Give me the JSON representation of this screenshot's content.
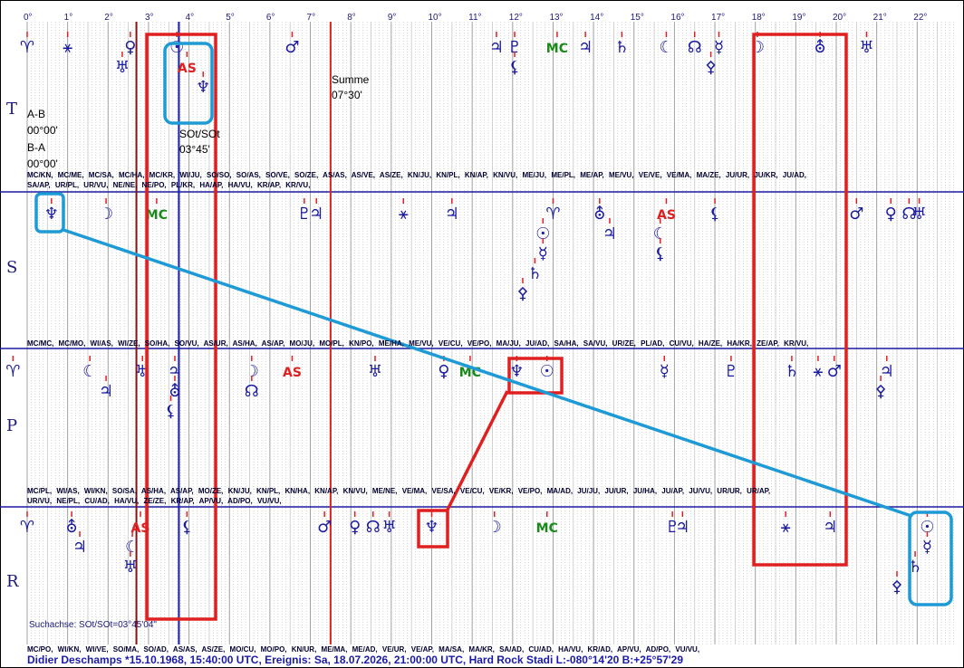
{
  "degree_labels": [
    "0°",
    "1°",
    "2°",
    "3°",
    "4°",
    "5°",
    "6°",
    "7°",
    "8°",
    "9°",
    "10°",
    "11°",
    "12°",
    "13°",
    "14°",
    "15°",
    "16°",
    "17°",
    "18°",
    "19°",
    "20°",
    "21°",
    "22°"
  ],
  "row_labels": [
    "T",
    "S",
    "P",
    "R"
  ],
  "info": {
    "ab_label": "A-B",
    "ab_value": "00°00'",
    "ba_label": "B-A",
    "ba_value": "00°00'",
    "summe_label": "Summe",
    "summe_value": "07°30'",
    "sot_label": "SOt/SOt",
    "sot_value": "03°45'"
  },
  "strips": {
    "strip1_line1": "MC/KN, MC/ME, MC/SA, MC/HA, MC/KR, WI/JU, SO/SO, SO/AS, SO/VE, SO/ZE, AS/AS, AS/VE, AS/ZE, KN/JU, KN/PL, KN/AP, KN/VU, ME/JU, ME/PL, ME/AP, ME/VU, VE/VE, VE/MA, MA/ZE, JU/UR, JU/KR, JU/AD,",
    "strip1_line2": "SA/AP, UR/PL, UR/VU, NE/NE, NE/PO, PL/KR, HA/AP, HA/VU, KR/AP, KR/VU,",
    "strip2_line1": "MC/MC, MC/MO, WI/AS, WI/ZE, SO/HA, SO/VU, AS/UR, AS/HA, AS/AP, MO/JU, MO/PL, KN/PO, ME/HA, ME/VU, VE/CU, VE/PO, MA/JU, JU/AD, SA/HA, SA/VU, UR/ZE, PL/AD, CU/VU, HA/ZE, HA/KR, ZE/AP, KR/VU,",
    "strip3_line1": "MC/PL, WI/AS, WI/KN, SO/SA, AS/HA, AS/AP, MO/ZE, KN/JU, KN/PL, KN/HA, KN/AP, KN/VU, ME/NE, VE/MA, VE/SA, VE/CU, VE/KR, VE/PO, MA/AD, JU/JU, JU/UR, JU/HA, JU/AP, JU/VU, UR/UR, UR/AP,",
    "strip3_line2": "UR/VU, NE/PL, CU/AD, HA/VU, ZE/ZE, KR/AP, AP/VU, AD/PO, VU/VU,",
    "strip4_line1": "MC/PO, WI/KN, WI/VE, SO/MA, SO/AD, AS/AS, AS/ZE, MO/CU, MO/PO, KN/UR, ME/MA, ME/AD, VE/UR, VE/AP, MA/SA, MA/KR, SA/AD, CU/AD, HA/VU, KR/AD, AP/VU, AD/PO, VU/VU,"
  },
  "search_axis": "Suchachse: SOt/SOt=03°45'04\"",
  "footer": "Didier Deschamps  *15.10.1968, 15:40:00 UTC, Ereignis: Sa, 18.07.2026, 21:00:00 UTC, Hard Rock Stadi L:-080°14'20 B:+25°57'29",
  "colors": {
    "navy": "#1a1aa0",
    "red": "#e02020",
    "green": "#1a8a1a",
    "cyan": "#1e9ad6",
    "grid": "#a0a0a0"
  },
  "symbols": [
    {
      "row": "T",
      "g": "♈",
      "v": 0,
      "t": 0,
      "c": "navy"
    },
    {
      "row": "T",
      "g": "⚹",
      "v": 1,
      "t": 0,
      "c": "navy"
    },
    {
      "row": "T",
      "g": "♀",
      "v": 2.55,
      "t": 0,
      "c": "navy"
    },
    {
      "row": "T",
      "g": "♅",
      "v": 2.35,
      "t": 1,
      "c": "navy"
    },
    {
      "row": "T",
      "g": "☉",
      "v": 3.7,
      "t": 0,
      "c": "navy"
    },
    {
      "row": "T",
      "g": "AS",
      "v": 3.95,
      "t": 1,
      "c": "red"
    },
    {
      "row": "T",
      "g": "♆",
      "v": 4.35,
      "t": 2,
      "c": "navy"
    },
    {
      "row": "T",
      "g": "♂",
      "v": 6.55,
      "t": 0,
      "c": "navy"
    },
    {
      "row": "T",
      "g": "♃",
      "v": 11.6,
      "t": 0,
      "c": "navy"
    },
    {
      "row": "T",
      "g": "♇",
      "v": 12.05,
      "t": 0,
      "c": "navy"
    },
    {
      "row": "T",
      "g": "⚸",
      "v": 12.05,
      "t": 1,
      "c": "navy"
    },
    {
      "row": "T",
      "g": "MC",
      "v": 13.1,
      "t": 0,
      "c": "green"
    },
    {
      "row": "T",
      "g": "♃",
      "v": 13.8,
      "t": 0,
      "c": "navy"
    },
    {
      "row": "T",
      "g": "♄",
      "v": 14.7,
      "t": 0,
      "c": "navy"
    },
    {
      "row": "T",
      "g": "☾",
      "v": 15.8,
      "t": 0,
      "c": "navy"
    },
    {
      "row": "T",
      "g": "☊",
      "v": 16.5,
      "t": 0,
      "c": "navy"
    },
    {
      "row": "T",
      "g": "☿",
      "v": 17.1,
      "t": 0,
      "c": "navy"
    },
    {
      "row": "T",
      "g": "⚴",
      "v": 16.9,
      "t": 1,
      "c": "navy"
    },
    {
      "row": "T",
      "g": "☽",
      "v": 18.05,
      "t": 0,
      "c": "navy"
    },
    {
      "row": "T",
      "g": "⛢",
      "v": 19.6,
      "t": 0,
      "c": "navy"
    },
    {
      "row": "T",
      "g": "♅",
      "v": 20.75,
      "t": 0,
      "c": "navy"
    },
    {
      "row": "S",
      "g": "♆",
      "v": 0.6,
      "t": 0,
      "c": "navy"
    },
    {
      "row": "S",
      "g": "☽",
      "v": 1.95,
      "t": 0,
      "c": "navy"
    },
    {
      "row": "S",
      "g": "MC",
      "v": 3.2,
      "t": 0,
      "c": "green"
    },
    {
      "row": "S",
      "g": "♇",
      "v": 6.85,
      "t": 0,
      "c": "navy"
    },
    {
      "row": "S",
      "g": "♃",
      "v": 7.15,
      "t": 0,
      "c": "navy"
    },
    {
      "row": "S",
      "g": "⚹",
      "v": 9.3,
      "t": 0,
      "c": "navy"
    },
    {
      "row": "S",
      "g": "♃",
      "v": 10.5,
      "t": 0,
      "c": "navy"
    },
    {
      "row": "S",
      "g": "♈",
      "v": 13.0,
      "t": 0,
      "c": "navy"
    },
    {
      "row": "S",
      "g": "☉",
      "v": 12.75,
      "t": 1,
      "c": "navy"
    },
    {
      "row": "S",
      "g": "☿",
      "v": 12.75,
      "t": 2,
      "c": "navy"
    },
    {
      "row": "S",
      "g": "♄",
      "v": 12.55,
      "t": 3,
      "c": "navy"
    },
    {
      "row": "S",
      "g": "⚴",
      "v": 12.25,
      "t": 4,
      "c": "navy"
    },
    {
      "row": "S",
      "g": "⛢",
      "v": 14.15,
      "t": 0,
      "c": "navy"
    },
    {
      "row": "S",
      "g": "♃",
      "v": 14.4,
      "t": 1,
      "c": "navy"
    },
    {
      "row": "S",
      "g": "AS",
      "v": 15.8,
      "t": 0,
      "c": "red"
    },
    {
      "row": "S",
      "g": "☾",
      "v": 15.65,
      "t": 1,
      "c": "navy"
    },
    {
      "row": "S",
      "g": "⚸",
      "v": 15.65,
      "t": 2,
      "c": "navy"
    },
    {
      "row": "S",
      "g": "⚸",
      "v": 17.0,
      "t": 0,
      "c": "navy"
    },
    {
      "row": "S",
      "g": "♂",
      "v": 20.5,
      "t": 0,
      "c": "navy"
    },
    {
      "row": "S",
      "g": "♀",
      "v": 21.35,
      "t": 0,
      "c": "navy"
    },
    {
      "row": "S",
      "g": "☊",
      "v": 21.8,
      "t": 0,
      "c": "navy"
    },
    {
      "row": "S",
      "g": "♅",
      "v": 22.05,
      "t": 0,
      "c": "navy"
    },
    {
      "row": "P",
      "g": "♈",
      "v": -0.35,
      "t": 0,
      "c": "navy"
    },
    {
      "row": "P",
      "g": "☾",
      "v": 1.55,
      "t": 0,
      "c": "navy"
    },
    {
      "row": "P",
      "g": "♃",
      "v": 1.95,
      "t": 1,
      "c": "navy"
    },
    {
      "row": "P",
      "g": "♅",
      "v": 2.85,
      "t": 0,
      "c": "navy"
    },
    {
      "row": "P",
      "g": "♃",
      "v": 3.65,
      "t": 0,
      "c": "navy"
    },
    {
      "row": "P",
      "g": "⛢",
      "v": 3.65,
      "t": 1,
      "c": "navy"
    },
    {
      "row": "P",
      "g": "⚸",
      "v": 3.55,
      "t": 2,
      "c": "navy"
    },
    {
      "row": "P",
      "g": "☽",
      "v": 5.55,
      "t": 0,
      "c": "navy"
    },
    {
      "row": "P",
      "g": "☊",
      "v": 5.55,
      "t": 1,
      "c": "navy"
    },
    {
      "row": "P",
      "g": "AS",
      "v": 6.55,
      "t": 0,
      "c": "red"
    },
    {
      "row": "P",
      "g": "♅",
      "v": 8.6,
      "t": 0,
      "c": "navy"
    },
    {
      "row": "P",
      "g": "♀",
      "v": 10.3,
      "t": 0,
      "c": "navy"
    },
    {
      "row": "P",
      "g": "MC",
      "v": 10.95,
      "t": 0,
      "c": "green"
    },
    {
      "row": "P",
      "g": "♆",
      "v": 12.1,
      "t": 0,
      "c": "navy"
    },
    {
      "row": "P",
      "g": "☉",
      "v": 12.85,
      "t": 0,
      "c": "navy"
    },
    {
      "row": "P",
      "g": "☿",
      "v": 15.75,
      "t": 0,
      "c": "navy"
    },
    {
      "row": "P",
      "g": "♇",
      "v": 17.4,
      "t": 0,
      "c": "navy"
    },
    {
      "row": "P",
      "g": "♄",
      "v": 18.9,
      "t": 0,
      "c": "navy"
    },
    {
      "row": "P",
      "g": "⚹",
      "v": 19.55,
      "t": 0,
      "c": "navy"
    },
    {
      "row": "P",
      "g": "♂",
      "v": 19.95,
      "t": 0,
      "c": "navy"
    },
    {
      "row": "P",
      "g": "♃",
      "v": 21.25,
      "t": 0,
      "c": "navy"
    },
    {
      "row": "P",
      "g": "⚴",
      "v": 21.1,
      "t": 1,
      "c": "navy"
    },
    {
      "row": "R",
      "g": "♈",
      "v": 0,
      "t": 0,
      "c": "navy"
    },
    {
      "row": "R",
      "g": "⛢",
      "v": 1.1,
      "t": 0,
      "c": "navy"
    },
    {
      "row": "R",
      "g": "♃",
      "v": 1.3,
      "t": 1,
      "c": "navy"
    },
    {
      "row": "R",
      "g": "AS",
      "v": 2.8,
      "t": 0,
      "c": "red"
    },
    {
      "row": "R",
      "g": "☾",
      "v": 2.6,
      "t": 1,
      "c": "navy"
    },
    {
      "row": "R",
      "g": "♅",
      "v": 2.55,
      "t": 2,
      "c": "navy"
    },
    {
      "row": "R",
      "g": "⚸",
      "v": 3.95,
      "t": 0,
      "c": "navy"
    },
    {
      "row": "R",
      "g": "♂",
      "v": 7.35,
      "t": 0,
      "c": "navy"
    },
    {
      "row": "R",
      "g": "♀",
      "v": 8.1,
      "t": 0,
      "c": "navy"
    },
    {
      "row": "R",
      "g": "☊",
      "v": 8.55,
      "t": 0,
      "c": "navy"
    },
    {
      "row": "R",
      "g": "♅",
      "v": 8.95,
      "t": 0,
      "c": "navy"
    },
    {
      "row": "R",
      "g": "♆",
      "v": 10.0,
      "t": 0,
      "c": "navy"
    },
    {
      "row": "R",
      "g": "☽",
      "v": 11.55,
      "t": 0,
      "c": "navy"
    },
    {
      "row": "R",
      "g": "MC",
      "v": 12.85,
      "t": 0,
      "c": "green"
    },
    {
      "row": "R",
      "g": "♇",
      "v": 15.95,
      "t": 0,
      "c": "navy"
    },
    {
      "row": "R",
      "g": "♃",
      "v": 16.2,
      "t": 0,
      "c": "navy"
    },
    {
      "row": "R",
      "g": "⚹",
      "v": 18.75,
      "t": 0,
      "c": "navy"
    },
    {
      "row": "R",
      "g": "♃",
      "v": 19.85,
      "t": 0,
      "c": "navy"
    },
    {
      "row": "R",
      "g": "☉",
      "v": 22.25,
      "t": 0,
      "c": "navy"
    },
    {
      "row": "R",
      "g": "☿",
      "v": 22.25,
      "t": 1,
      "c": "navy"
    },
    {
      "row": "R",
      "g": "♄",
      "v": 21.95,
      "t": 2,
      "c": "navy"
    },
    {
      "row": "R",
      "g": "⚴",
      "v": 21.5,
      "t": 3,
      "c": "navy"
    }
  ]
}
